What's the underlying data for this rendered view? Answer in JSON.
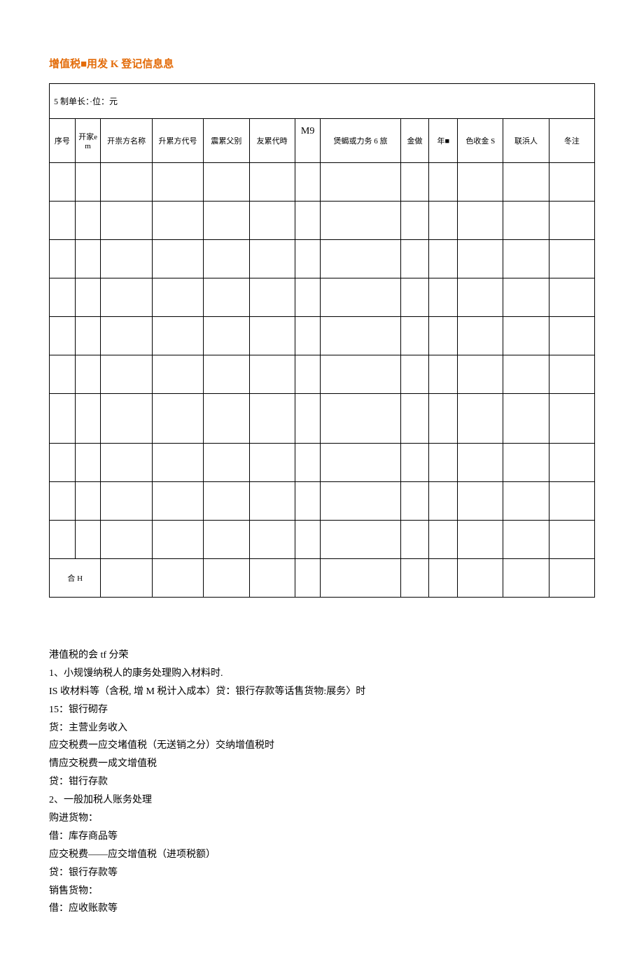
{
  "title": "增值税■用发 K 登记信息息",
  "table": {
    "caption": "5 制单长：·位：元",
    "headers": [
      "序号",
      "开家em",
      "开祟方名称",
      "升累方代号",
      "震累父别",
      "友累代時",
      "M9",
      "煲蝎或力务 6 旅",
      "金做",
      "年■",
      "色收金 S",
      "联浜人",
      "冬注"
    ],
    "footer": "合 H"
  },
  "content": {
    "lines": [
      "港值税的会 tf 分荣",
      "1、小规馒纳税人的康务处理购入材料时.",
      "IS 收材料等（含税, 增 M 税计入成本）贷：银行存款等话售货物:展务〉时",
      "15：银行砌存",
      "货：主营业务收入",
      "应交税费一应交堵值税（无送销之分）交纳增值税时",
      "情应交税费一成文增值税",
      "贷：钳行存款",
      "2、一般加税人账务处理",
      "购进货物：",
      "借：库存商品等",
      "应交税费——应交增值税（进项税额）",
      "贷：银行存款等",
      "销售货物：",
      "借：应收账款等"
    ]
  }
}
